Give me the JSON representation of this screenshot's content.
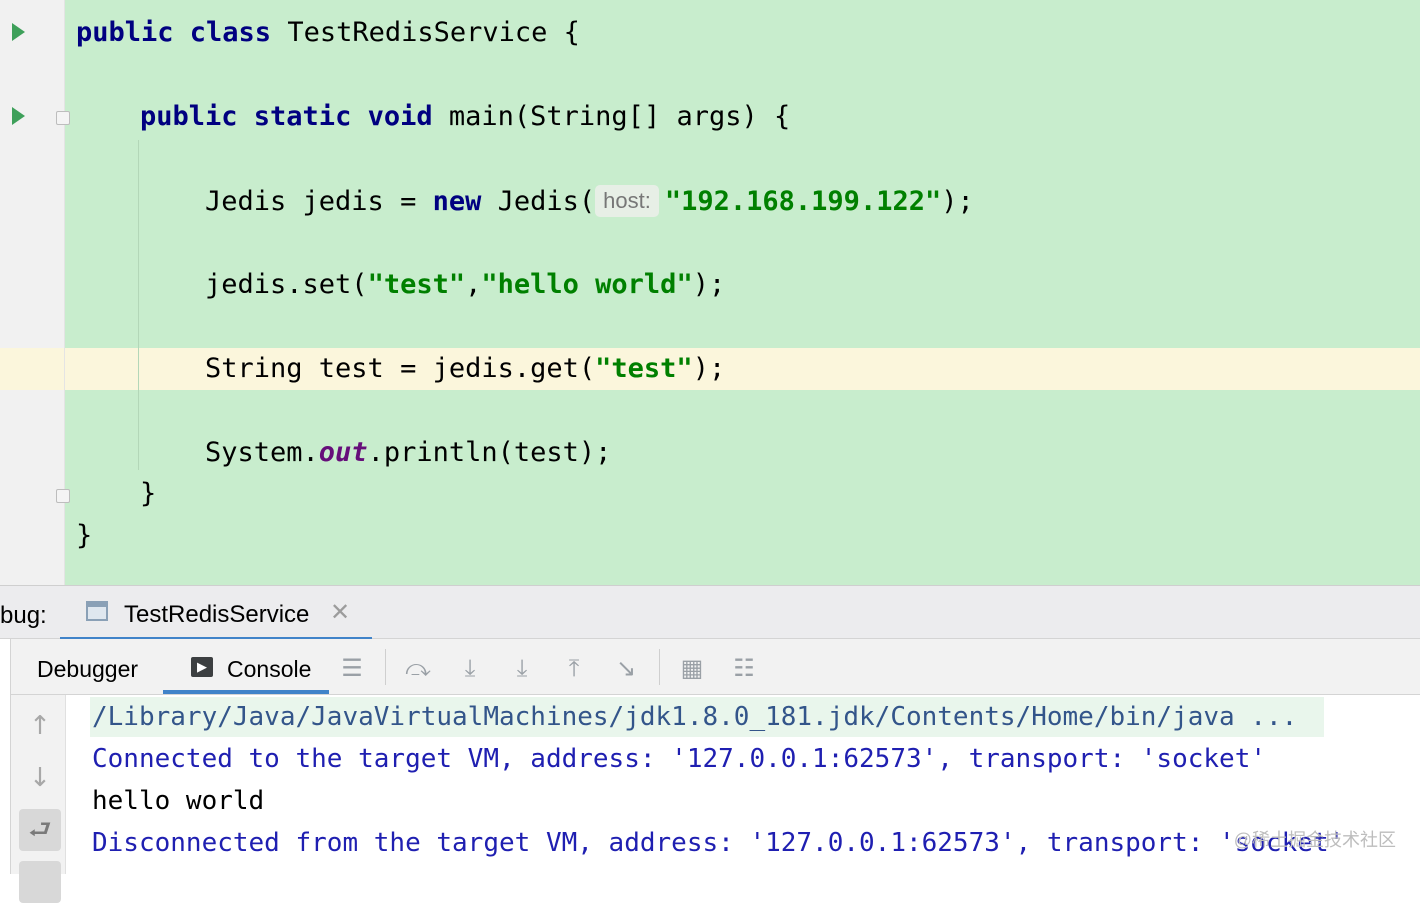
{
  "colors": {
    "editor_bg": "#c8edcd",
    "current_line_bg": "#fbf6dc",
    "keyword": "#000080",
    "string": "#008000",
    "accent": "#4083c9",
    "console_text": "#1f1fb1"
  },
  "editor": {
    "code": {
      "l1_kw": "public class",
      "l1_name": "TestRedisService {",
      "l2_kw": "public static void",
      "l2_rest": "main(String[] args) {",
      "l3_a": "Jedis jedis = ",
      "l3_kw": "new",
      "l3_b": "Jedis(",
      "l3_hint": "host:",
      "l3_str": "\"192.168.199.122\"",
      "l3_end": ");",
      "l4_a": "jedis.set(",
      "l4_s1": "\"test\"",
      "l4_comma": ",",
      "l4_s2": "\"hello world\"",
      "l4_end": ");",
      "l5_a": "String test = jedis.get(",
      "l5_s": "\"test\"",
      "l5_end": ");",
      "l6_a": "System.",
      "l6_field": "out",
      "l6_b": ".println(test);",
      "l7": "}",
      "l8": "}"
    }
  },
  "debug": {
    "label": "bug:",
    "session_tab": "TestRedisService",
    "close_icon": "close-icon",
    "toolbar": {
      "debugger_tab": "Debugger",
      "console_tab": "Console",
      "icons": [
        "threads-icon",
        "step-over-icon",
        "step-into-icon",
        "force-step-into-icon",
        "step-out-icon",
        "run-to-cursor-icon",
        "evaluate-expression-icon",
        "trace-icon"
      ]
    }
  },
  "console": {
    "lines": [
      "/Library/Java/JavaVirtualMachines/jdk1.8.0_181.jdk/Contents/Home/bin/java ...",
      "Connected to the target VM, address: '127.0.0.1:62573', transport: 'socket'",
      "hello world",
      "Disconnected from the target VM, address: '127.0.0.1:62573', transport: 'socket'"
    ]
  },
  "watermark": "@稀土掘金技术社区"
}
